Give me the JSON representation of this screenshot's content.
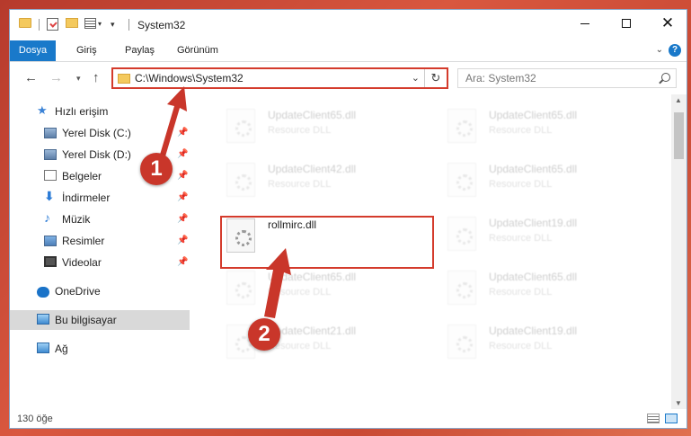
{
  "window": {
    "title": "System32"
  },
  "ribbon": {
    "tabs": [
      {
        "label": "Dosya"
      },
      {
        "label": "Giriş"
      },
      {
        "label": "Paylaş"
      },
      {
        "label": "Görünüm"
      }
    ],
    "help": "?"
  },
  "nav": {
    "address": "C:\\Windows\\System32",
    "search_placeholder": "Ara: System32"
  },
  "sidebar": {
    "items": [
      {
        "label": "Hızlı erişim",
        "icon": "star-icon"
      },
      {
        "label": "Yerel Disk (C:)",
        "icon": "disk-icon",
        "pinned": true
      },
      {
        "label": "Yerel Disk (D:)",
        "icon": "disk-icon",
        "pinned": true
      },
      {
        "label": "Belgeler",
        "icon": "documents-icon",
        "pinned": true
      },
      {
        "label": "İndirmeler",
        "icon": "downloads-icon",
        "pinned": true
      },
      {
        "label": "Müzik",
        "icon": "music-icon",
        "pinned": true
      },
      {
        "label": "Resimler",
        "icon": "pictures-icon",
        "pinned": true
      },
      {
        "label": "Videolar",
        "icon": "videos-icon",
        "pinned": true
      },
      {
        "label": "OneDrive",
        "icon": "onedrive-icon"
      },
      {
        "label": "Bu bilgisayar",
        "icon": "this-pc-icon",
        "selected": true
      },
      {
        "label": "Ağ",
        "icon": "network-icon"
      }
    ]
  },
  "files": {
    "col1": [
      {
        "name": "UpdateClient65.dll",
        "desc": "Resource DLL"
      },
      {
        "name": "UpdateClient42.dll",
        "desc": "Resource DLL"
      },
      {
        "name": "rollmirc.dll",
        "desc": ""
      },
      {
        "name": "UpdateClient65.dll",
        "desc": "Resource DLL"
      },
      {
        "name": "UpdateClient21.dll",
        "desc": "Resource DLL"
      }
    ],
    "col2": [
      {
        "name": "UpdateClient65.dll",
        "desc": "Resource DLL"
      },
      {
        "name": "UpdateClient65.dll",
        "desc": "Resource DLL"
      },
      {
        "name": "UpdateClient19.dll",
        "desc": "Resource DLL"
      },
      {
        "name": "UpdateClient65.dll",
        "desc": "Resource DLL"
      },
      {
        "name": "UpdateClient19.dll",
        "desc": "Resource DLL"
      }
    ]
  },
  "status": {
    "item_count": "130 öğe"
  },
  "annotations": {
    "step1": "1",
    "step2": "2",
    "color": "#c9362a"
  }
}
